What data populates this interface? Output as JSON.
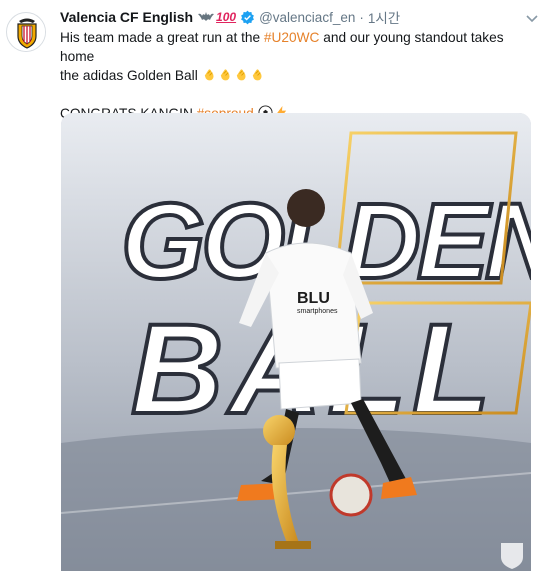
{
  "tweet": {
    "display_name": "Valencia CF English",
    "hundred": "100",
    "handle": "@valenciacf_en",
    "separator": "·",
    "time": "1시간",
    "text_line1_a": "His team made a great run at the ",
    "hashtag1": "#U20WC",
    "text_line1_b": " and our young standout takes home",
    "text_line2": "the adidas Golden Ball",
    "text_line3": "CONGRATS KANGIN ",
    "hashtag2": "#soproud"
  },
  "icons": {
    "avatar": "valencia-crest-icon",
    "bat": "bat-emoji-icon",
    "verified": "verified-badge-icon",
    "caret": "chevron-down-icon",
    "clap": "clapping-hands-emoji-icon",
    "soccer": "soccer-ball-emoji-icon",
    "lightning": "lightning-emoji-icon"
  },
  "media": {
    "word1": "GOLDEN",
    "word2": "BALL",
    "shirt_sponsor": "BLU",
    "shirt_sponsor_sub": "smartphones"
  },
  "colors": {
    "link": "#e6822b",
    "verified": "#1da1f2",
    "muted": "#657786",
    "gold": "#f3b43a"
  }
}
